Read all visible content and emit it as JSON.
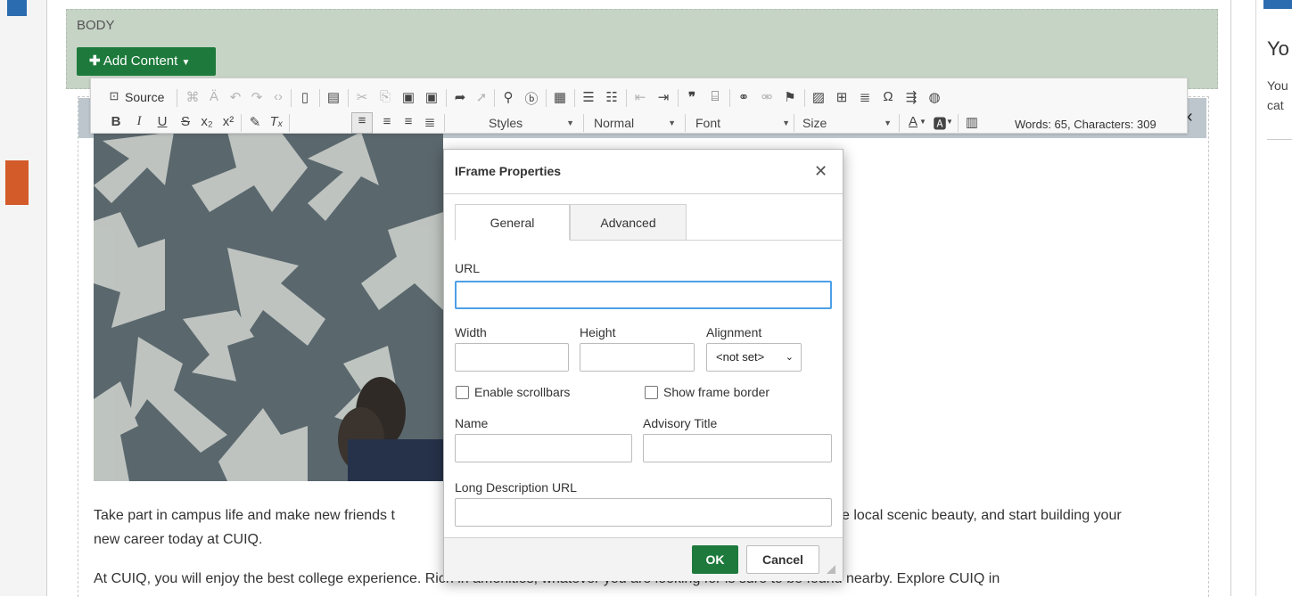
{
  "body_region": {
    "label": "BODY",
    "add_content": "Add Content"
  },
  "toolbar": {
    "source": "Source",
    "styles": "Styles",
    "format": "Normal",
    "font": "Font",
    "size": "Size",
    "word_count": "Words: 65, Characters: 309"
  },
  "article": {
    "p1_left": "Take part in campus life and make new friends t",
    "p1_right": "e local scenic beauty, and start building your",
    "p1_line2": "new career today at CUIQ.",
    "p2": "At CUIQ, you will enjoy the best college experience. Rich in amenities, whatever you are looking for is sure to be found nearby.  Explore CUIQ in"
  },
  "right_panel": {
    "title": "Yo",
    "text1": "You",
    "text2": "cat"
  },
  "dialog": {
    "title": "IFrame Properties",
    "tabs": [
      "General",
      "Advanced"
    ],
    "url_label": "URL",
    "url_value": "",
    "width_label": "Width",
    "height_label": "Height",
    "alignment_label": "Alignment",
    "alignment_value": "<not set>",
    "enable_scrollbars": "Enable scrollbars",
    "show_frame_border": "Show frame border",
    "name_label": "Name",
    "advisory_title_label": "Advisory Title",
    "long_desc_label": "Long Description URL",
    "ok": "OK",
    "cancel": "Cancel"
  },
  "colors": {
    "accent_green": "#1e7a3c",
    "focus_blue": "#4da0e8",
    "body_bg": "#c6d4c6"
  }
}
